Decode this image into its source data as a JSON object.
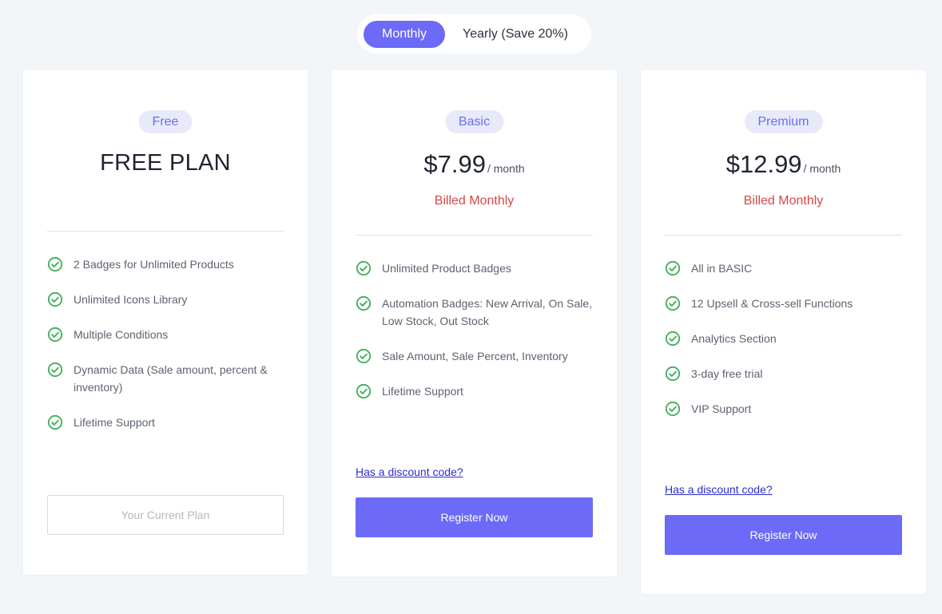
{
  "toggle": {
    "monthly_label": "Monthly",
    "yearly_label": "Yearly (Save 20%)",
    "selected": "Monthly"
  },
  "colors": {
    "accent": "#6c6af7",
    "badge_bg": "#e8eaf9",
    "billed_text": "#d84747",
    "check": "#3fae5a",
    "link": "#2c2ccf"
  },
  "plans": {
    "free": {
      "badge": "Free",
      "title": "FREE PLAN",
      "features": [
        "2 Badges for Unlimited Products",
        "Unlimited Icons Library",
        "Multiple Conditions",
        "Dynamic Data (Sale amount, percent & inventory)",
        "Lifetime Support"
      ],
      "button_label": "Your Current Plan"
    },
    "basic": {
      "badge": "Basic",
      "price": "$7.99",
      "period": "/ month",
      "billed": "Billed Monthly",
      "features": [
        "Unlimited Product Badges",
        "Automation Badges: New Arrival, On Sale, Low Stock, Out Stock",
        "Sale Amount, Sale Percent, Inventory",
        "Lifetime Support"
      ],
      "discount_link": "Has a discount code?",
      "button_label": "Register Now"
    },
    "premium": {
      "badge": "Premium",
      "price": "$12.99",
      "period": "/ month",
      "billed": "Billed Monthly",
      "features": [
        "All in BASIC",
        "12 Upsell & Cross-sell Functions",
        "Analytics Section",
        "3-day free trial",
        "VIP Support"
      ],
      "discount_link": "Has a discount code?",
      "button_label": "Register Now"
    }
  },
  "icons": {
    "feature_bullet": "check-circle-icon"
  }
}
